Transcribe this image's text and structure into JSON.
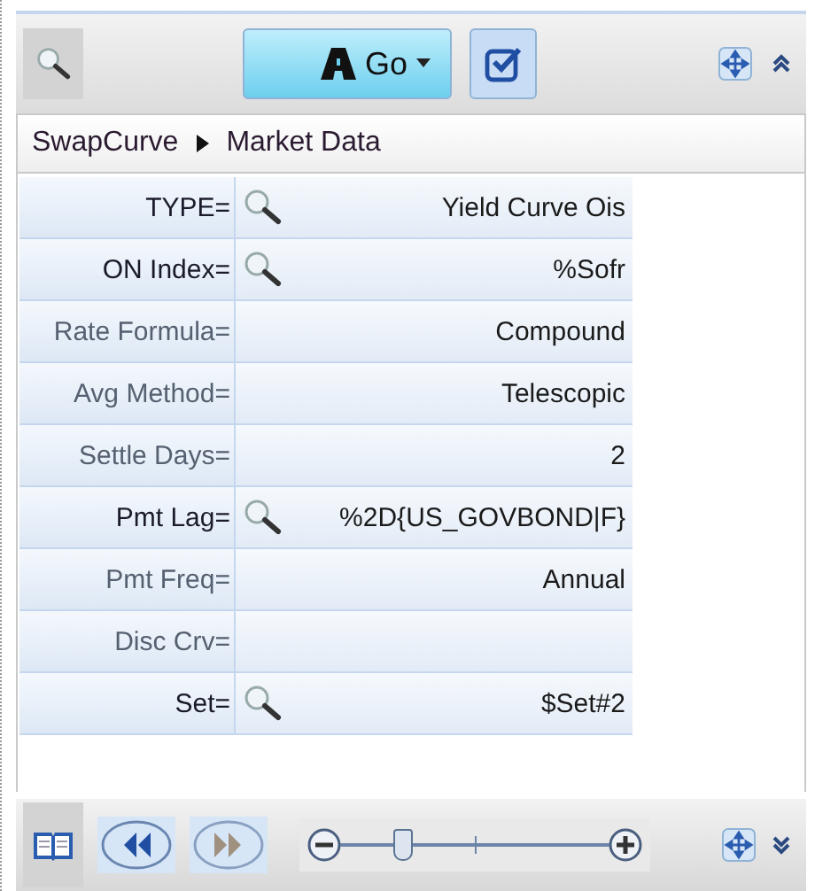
{
  "toolbar": {
    "go_button": {
      "label": "Go"
    },
    "check_toggle": {
      "selected": true
    }
  },
  "breadcrumb": [
    "SwapCurve",
    "Market Data"
  ],
  "fields": [
    {
      "label": "TYPE=",
      "value": "Yield Curve Ois",
      "lookup": true
    },
    {
      "label": "ON Index=",
      "value": "%Sofr",
      "lookup": true
    },
    {
      "label": "Rate Formula=",
      "value": "Compound",
      "lookup": false
    },
    {
      "label": "Avg Method=",
      "value": "Telescopic",
      "lookup": false
    },
    {
      "label": "Settle Days=",
      "value": "2",
      "lookup": false
    },
    {
      "label": "Pmt Lag=",
      "value": "%2D{US_GOVBOND|F}",
      "lookup": true
    },
    {
      "label": "Pmt Freq=",
      "value": "Annual",
      "lookup": false
    },
    {
      "label": "Disc Crv=",
      "lookup": false
    },
    {
      "label": "Set=",
      "value": "$Set#2",
      "lookup": true
    }
  ],
  "footer": {
    "back_button": {
      "disabled": false
    },
    "forward_button": {
      "disabled": true
    },
    "zoom": {
      "level": 0.23
    }
  }
}
